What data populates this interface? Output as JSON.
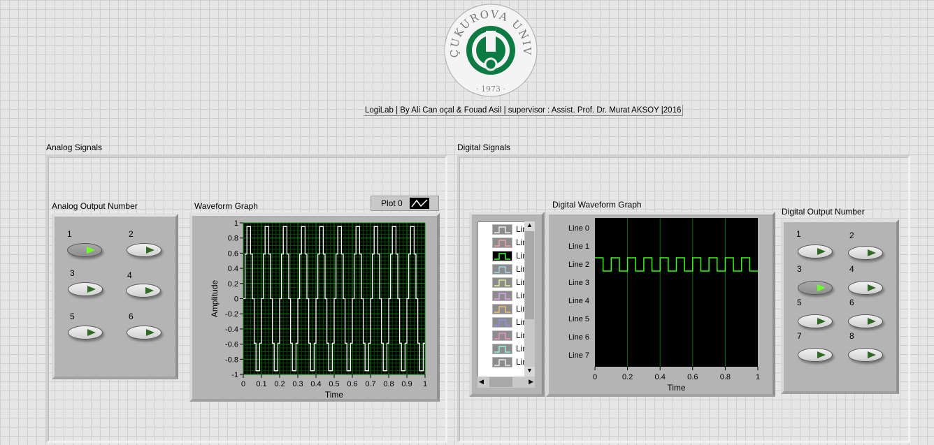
{
  "logo": {
    "text_top": "ÇUKUROVA UNIVERSITY",
    "year": "1973"
  },
  "credit": "LogiLab | By Ali Can oçal & Fouad Asil | supervisor : Assist. Prof. Dr. Murat AKSOY |2016",
  "analog": {
    "group_label": "Analog Signals",
    "output_label": "Analog Output Number",
    "buttons": [
      {
        "label": "1",
        "on": true
      },
      {
        "label": "2",
        "on": false
      },
      {
        "label": "3",
        "on": false
      },
      {
        "label": "4",
        "on": false
      },
      {
        "label": "5",
        "on": false
      },
      {
        "label": "6",
        "on": false
      }
    ]
  },
  "waveform": {
    "label": "Waveform Graph",
    "legend": "Plot 0"
  },
  "digital": {
    "group_label": "Digital Signals",
    "graph_label": "Digital Waveform Graph",
    "output_label": "Digital Output Number",
    "list_items": [
      "Lin",
      "Lin",
      "Lin",
      "Lin",
      "Lin",
      "Lin",
      "Lin",
      "Lin",
      "Lin",
      "Lin",
      "Lin"
    ],
    "list_colors": [
      "#e8e8e8",
      "#f0a0a0",
      "#33ff33",
      "#9fd4f0",
      "#e0f0a0",
      "#e0a0f0",
      "#f0c070",
      "#9090f0",
      "#f090c0",
      "#90f0e0",
      "#e8e8e8"
    ],
    "buttons": [
      {
        "label": "1",
        "on": false
      },
      {
        "label": "2",
        "on": false
      },
      {
        "label": "3",
        "on": true
      },
      {
        "label": "4",
        "on": false
      },
      {
        "label": "5",
        "on": false
      },
      {
        "label": "6",
        "on": false
      },
      {
        "label": "7",
        "on": false
      },
      {
        "label": "8",
        "on": false
      }
    ]
  },
  "chart_data": [
    {
      "type": "line",
      "title": "Waveform Graph",
      "xlabel": "Time",
      "ylabel": "Amplitude",
      "xlim": [
        0,
        1
      ],
      "ylim": [
        -1,
        1
      ],
      "xticks": [
        "0",
        "0.1",
        "0.2",
        "0.3",
        "0.4",
        "0.5",
        "0.6",
        "0.7",
        "0.8",
        "0.9",
        "1"
      ],
      "yticks": [
        "1",
        "0.8",
        "0.6",
        "0.4",
        "0.2",
        "0",
        "-0.2",
        "-0.4",
        "-0.6",
        "-0.8",
        "-1"
      ],
      "series": [
        {
          "name": "Plot 0",
          "function": "sine",
          "frequency": 10,
          "amplitude": 1,
          "samples": 100,
          "color": "#ffffff"
        }
      ],
      "grid": true
    },
    {
      "type": "line",
      "title": "Digital Waveform Graph",
      "xlabel": "Time",
      "xlim": [
        0,
        1
      ],
      "xticks": [
        "0",
        "0.2",
        "0.4",
        "0.6",
        "0.8",
        "1"
      ],
      "lines": [
        "Line 0",
        "Line 1",
        "Line 2",
        "Line 3",
        "Line 4",
        "Line 5",
        "Line 6",
        "Line 7"
      ],
      "series": [
        {
          "name": "Line 2",
          "type": "square",
          "period": 0.1,
          "start_high": true,
          "color": "#33ff00"
        }
      ]
    }
  ]
}
